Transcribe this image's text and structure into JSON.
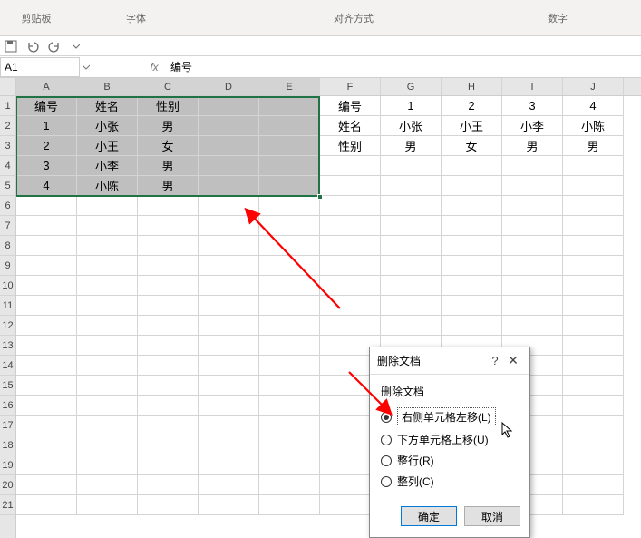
{
  "ribbon": {
    "label_clipboard": "剪贴板",
    "label_font": "字体",
    "label_align": "对齐方式",
    "label_number": "数字"
  },
  "name_box": {
    "value": "A1"
  },
  "formula_bar": {
    "value": "编号"
  },
  "columns": [
    "A",
    "B",
    "C",
    "D",
    "E",
    "F",
    "G",
    "H",
    "I",
    "J"
  ],
  "rows": [
    "1",
    "2",
    "3",
    "4",
    "5",
    "6",
    "7",
    "8",
    "9",
    "10",
    "11",
    "12",
    "13",
    "14",
    "15",
    "16",
    "17",
    "18",
    "19",
    "20",
    "21"
  ],
  "left_table": {
    "header": [
      "编号",
      "姓名",
      "性别"
    ],
    "rows": [
      [
        "1",
        "小张",
        "男"
      ],
      [
        "2",
        "小王",
        "女"
      ],
      [
        "3",
        "小李",
        "男"
      ],
      [
        "4",
        "小陈",
        "男"
      ]
    ]
  },
  "right_table": {
    "r1": [
      "编号",
      "1",
      "2",
      "3",
      "4"
    ],
    "r2": [
      "姓名",
      "小张",
      "小王",
      "小李",
      "小陈"
    ],
    "r3": [
      "性别",
      "男",
      "女",
      "男",
      "男"
    ]
  },
  "dialog": {
    "title": "删除文档",
    "group": "删除文档",
    "opt1": "右侧单元格左移(L)",
    "opt2": "下方单元格上移(U)",
    "opt3": "整行(R)",
    "opt4": "整列(C)",
    "ok": "确定",
    "cancel": "取消",
    "help": "?",
    "close": "✕"
  }
}
